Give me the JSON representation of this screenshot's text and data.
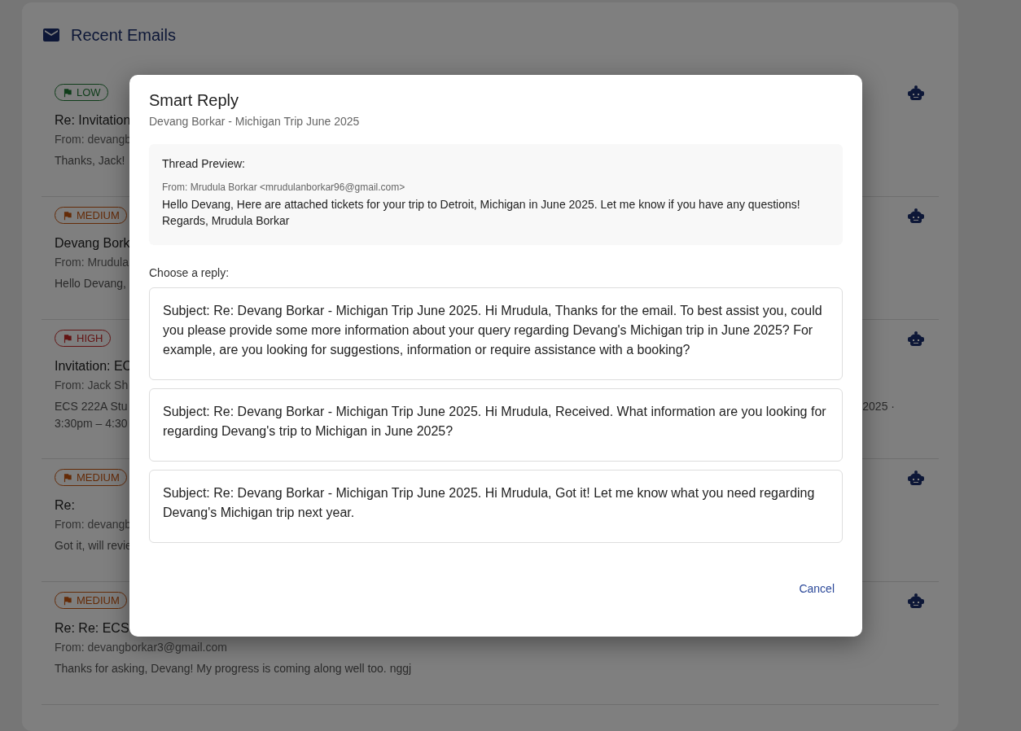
{
  "panel": {
    "title": "Recent Emails"
  },
  "emails": [
    {
      "kind": "low",
      "badge": "LOW",
      "subject": "Re: Invitation",
      "from": "From: devangb",
      "preview": [
        "Thanks, Jack!"
      ]
    },
    {
      "kind": "medium",
      "badge": "MEDIUM",
      "subject": "Devang Bork",
      "from": "From: Mrudula",
      "preview": [
        "Hello Devang,"
      ]
    },
    {
      "kind": "high",
      "badge": "HIGH",
      "subject": "Invitation: EC",
      "from": "From: Jack Sh",
      "preview": [
        "ECS 222A Stu",
        "3:30pm – 4:30"
      ],
      "preview_tail": "2025 ·"
    },
    {
      "kind": "medium",
      "badge": "MEDIUM",
      "subject": "Re:",
      "from": "From: devangb",
      "preview": [
        "Got it, will revie"
      ]
    },
    {
      "kind": "medium",
      "badge": "MEDIUM",
      "subject": "Re: Re: ECS",
      "from": "From: devangborkar3@gmail.com",
      "preview": [
        "Thanks for asking, Devang! My progress is coming along well too. nggj"
      ]
    }
  ],
  "dialog": {
    "title": "Smart Reply",
    "subtitle": "Devang Borkar - Michigan Trip June 2025",
    "thread": {
      "heading": "Thread Preview:",
      "from": "From: Mrudula Borkar <mrudulanborkar96@gmail.com>",
      "body": "Hello Devang, Here are attached tickets for your trip to Detroit, Michigan in June 2025. Let me know if you have any questions! Regards, Mrudula Borkar"
    },
    "prompt": "Choose a reply:",
    "replies": [
      "Subject: Re: Devang Borkar - Michigan Trip June 2025. Hi Mrudula, Thanks for the email. To best assist you, could you please provide some more information about your query regarding Devang's Michigan trip in June 2025? For example, are you looking for suggestions, information or require assistance with a booking?",
      "Subject: Re: Devang Borkar - Michigan Trip June 2025. Hi Mrudula, Received. What information are you looking for regarding Devang's trip to Michigan in June 2025?",
      "Subject: Re: Devang Borkar - Michigan Trip June 2025. Hi Mrudula, Got it! Let me know what you need regarding Devang's Michigan trip next year."
    ],
    "cancel": "Cancel"
  }
}
